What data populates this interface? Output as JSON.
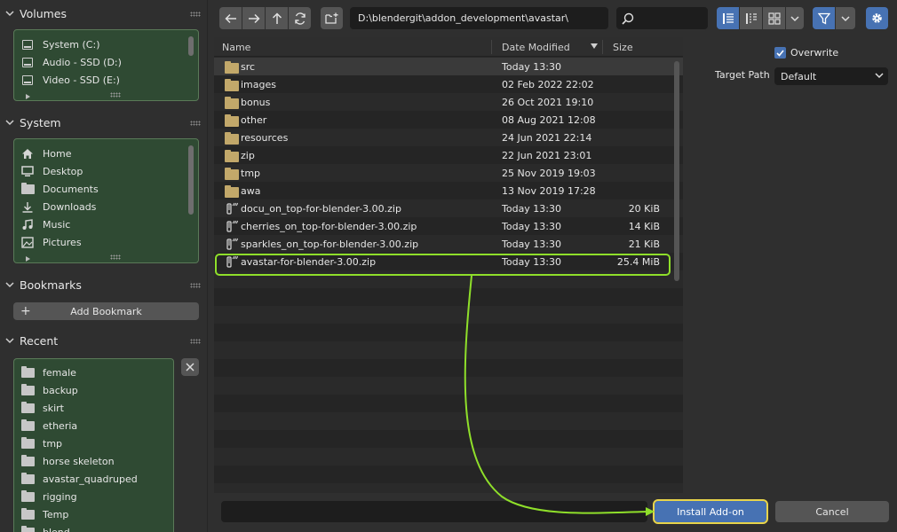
{
  "sidebar": {
    "volumes": {
      "title": "Volumes",
      "items": [
        {
          "label": "System (C:)"
        },
        {
          "label": "Audio - SSD (D:)"
        },
        {
          "label": "Video - SSD (E:)"
        }
      ]
    },
    "system": {
      "title": "System",
      "items": [
        {
          "label": "Home",
          "icon": "home-icon"
        },
        {
          "label": "Desktop",
          "icon": "desktop-icon"
        },
        {
          "label": "Documents",
          "icon": "documents-icon"
        },
        {
          "label": "Downloads",
          "icon": "download-icon"
        },
        {
          "label": "Music",
          "icon": "music-icon"
        },
        {
          "label": "Pictures",
          "icon": "pictures-icon"
        }
      ]
    },
    "bookmarks": {
      "title": "Bookmarks",
      "add_label": "Add Bookmark"
    },
    "recent": {
      "title": "Recent",
      "items": [
        {
          "label": "female"
        },
        {
          "label": "backup"
        },
        {
          "label": "skirt"
        },
        {
          "label": "etheria"
        },
        {
          "label": "tmp"
        },
        {
          "label": "horse skeleton"
        },
        {
          "label": "avastar_quadruped"
        },
        {
          "label": "rigging"
        },
        {
          "label": "Temp"
        },
        {
          "label": "blend"
        }
      ]
    }
  },
  "toolbar": {
    "path": "D:\\blendergit\\addon_development\\avastar\\",
    "search_placeholder": ""
  },
  "filelist": {
    "columns": {
      "name": "Name",
      "date": "Date Modified",
      "size": "Size"
    },
    "rows": [
      {
        "name": "src",
        "date": "Today 13:30",
        "size": "",
        "type": "folder"
      },
      {
        "name": "images",
        "date": "02 Feb 2022 22:02",
        "size": "",
        "type": "folder"
      },
      {
        "name": "bonus",
        "date": "26 Oct 2021 19:10",
        "size": "",
        "type": "folder"
      },
      {
        "name": "other",
        "date": "08 Aug 2021 12:08",
        "size": "",
        "type": "folder"
      },
      {
        "name": "resources",
        "date": "24 Jun 2021 22:14",
        "size": "",
        "type": "folder"
      },
      {
        "name": "zip",
        "date": "22 Jun 2021 23:01",
        "size": "",
        "type": "folder"
      },
      {
        "name": "tmp",
        "date": "25 Nov 2019 19:03",
        "size": "",
        "type": "folder"
      },
      {
        "name": "awa",
        "date": "13 Nov 2019 17:28",
        "size": "",
        "type": "folder"
      },
      {
        "name": "docu_on_top-for-blender-3.00.zip",
        "date": "Today 13:30",
        "size": "20 KiB",
        "type": "zip"
      },
      {
        "name": "cherries_on_top-for-blender-3.00.zip",
        "date": "Today 13:30",
        "size": "14 KiB",
        "type": "zip"
      },
      {
        "name": "sparkles_on_top-for-blender-3.00.zip",
        "date": "Today 13:30",
        "size": "21 KiB",
        "type": "zip"
      },
      {
        "name": "avastar-for-blender-3.00.zip",
        "date": "Today 13:30",
        "size": "25.4 MiB",
        "type": "zip"
      }
    ]
  },
  "options": {
    "overwrite_label": "Overwrite",
    "overwrite_checked": true,
    "target_path_label": "Target Path",
    "target_path_value": "Default"
  },
  "actions": {
    "filename_value": "",
    "install_label": "Install Add-on",
    "cancel_label": "Cancel"
  },
  "colors": {
    "accent": "#4772b3",
    "annotation": "#8fdf2a",
    "install_outline": "#e8d44a",
    "panel_green": "#2f4a33"
  }
}
